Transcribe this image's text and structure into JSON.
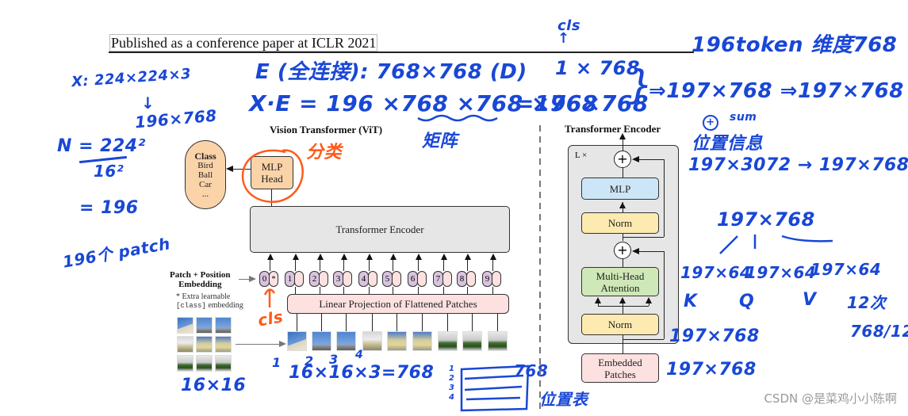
{
  "header": {
    "text": "Published as a conference paper at ICLR 2021"
  },
  "vit": {
    "title": "Vision Transformer (ViT)",
    "class_box": {
      "title": "Class",
      "items": [
        "Bird",
        "Ball",
        "Car",
        "..."
      ]
    },
    "mlp_head": {
      "line1": "MLP",
      "line2": "Head"
    },
    "encoder": "Transformer Encoder",
    "embedding_label": {
      "line1": "Patch + Position",
      "line2": "Embedding"
    },
    "footnote": {
      "line1": "* Extra learnable",
      "mono": "[class]",
      "line2": " embedding"
    },
    "tokens": [
      "0",
      "1",
      "2",
      "3",
      "4",
      "5",
      "6",
      "7",
      "8",
      "9"
    ],
    "cls_marker": "*",
    "linear_projection": "Linear Projection of Flattened Patches",
    "patch_count": 9
  },
  "encoder_detail": {
    "title": "Transformer Encoder",
    "repeat_label": "L ×",
    "plus_symbol": "+",
    "mlp": "MLP",
    "norm_top": "Norm",
    "mha": {
      "line1": "Multi-Head",
      "line2": "Attention"
    },
    "norm_bottom": "Norm",
    "embedded": {
      "line1": "Embedded",
      "line2": "Patches"
    }
  },
  "annotations": {
    "x_shape": "X: 224×224×3",
    "down_arrow": "↓",
    "x_flat": "196×768",
    "n_formula_num": "N = 224²",
    "n_formula_den": "16²",
    "n_result": "= 196",
    "n_patches": "196个 patch",
    "e_def": "E (全连接): 768×768 (D)",
    "xe_eq": "X·E = 196 ×768 ×768 ×768",
    "xe_result": "=196×768",
    "cls_top": "cls",
    "cls_arrow": "↑",
    "cls_shape": "1 × 768",
    "brace": "}",
    "concat_result": "⇒197×768 ⇒197×768",
    "token_note": "196token 维度768",
    "sum_mark": "+",
    "sum_label": "sum",
    "pos_info": "位置信息",
    "classify": "分类",
    "matrix": "矩阵",
    "cls_bottom": "cls",
    "mlp_dims": "197×3072 → 197×768",
    "qkv_src": "197×768",
    "qkv_shapes": [
      "197×64",
      "197×64",
      "197×64"
    ],
    "qkv_labels": [
      "K",
      "Q",
      "V"
    ],
    "heads": "12次",
    "head_dim": "768/12",
    "norm_dim": "197×768",
    "embed_dim": "197×768",
    "patch_nums": [
      "1",
      "2",
      "3",
      "4"
    ],
    "patch_size_formula": "16×16×3=768",
    "grid_label": "16×16",
    "pos_table_dim": "768",
    "pos_table_rows": [
      "1",
      "2",
      "3",
      "4"
    ],
    "pos_table_label": "位置表"
  },
  "watermark": "CSDN @是菜鸡小小陈啊"
}
